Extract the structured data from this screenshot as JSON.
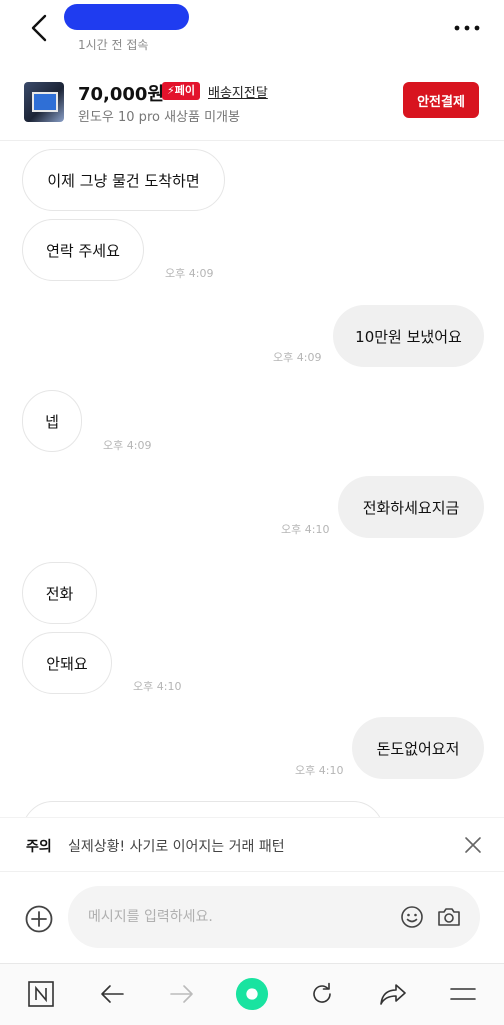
{
  "header": {
    "status": "1시간 전 접속",
    "back_icon": "chevron-left-icon",
    "more_icon": "more-horizontal-icon"
  },
  "product": {
    "price": "70,000원",
    "pay_badge": "⚡페이",
    "shipping": "배송지전달",
    "title": "윈도우 10 pro 새상품 미개봉",
    "safe_pay_button": "안전결제"
  },
  "messages": [
    {
      "side": "in",
      "text": "이제 그냥 물건 도착하면",
      "time": ""
    },
    {
      "side": "in",
      "text": "연락 주세요",
      "time": "오후 4:09"
    },
    {
      "side": "out",
      "text": "10만원 보냈어요",
      "time": "오후 4:09"
    },
    {
      "side": "in",
      "text": "넵",
      "time": "오후 4:09"
    },
    {
      "side": "out",
      "text": "전화하세요지금",
      "time": "오후 4:10"
    },
    {
      "side": "in",
      "text": "전화",
      "time": ""
    },
    {
      "side": "in",
      "text": "안돼요",
      "time": "오후 4:10"
    },
    {
      "side": "out",
      "text": "돈도없어요저",
      "time": "오후 4:10"
    }
  ],
  "warning": {
    "label": "주의",
    "text": "실제상황! 사기로 이어지는 거래 패턴"
  },
  "composer": {
    "placeholder": "메시지를 입력하세요."
  },
  "browser_bar": {
    "icons": [
      "naver-n-icon",
      "back-arrow-icon",
      "forward-arrow-icon",
      "home-dot-icon",
      "refresh-icon",
      "share-icon",
      "menu-icon"
    ],
    "accent": "#19e3a0"
  },
  "colors": {
    "brand_red": "#d8141f"
  }
}
